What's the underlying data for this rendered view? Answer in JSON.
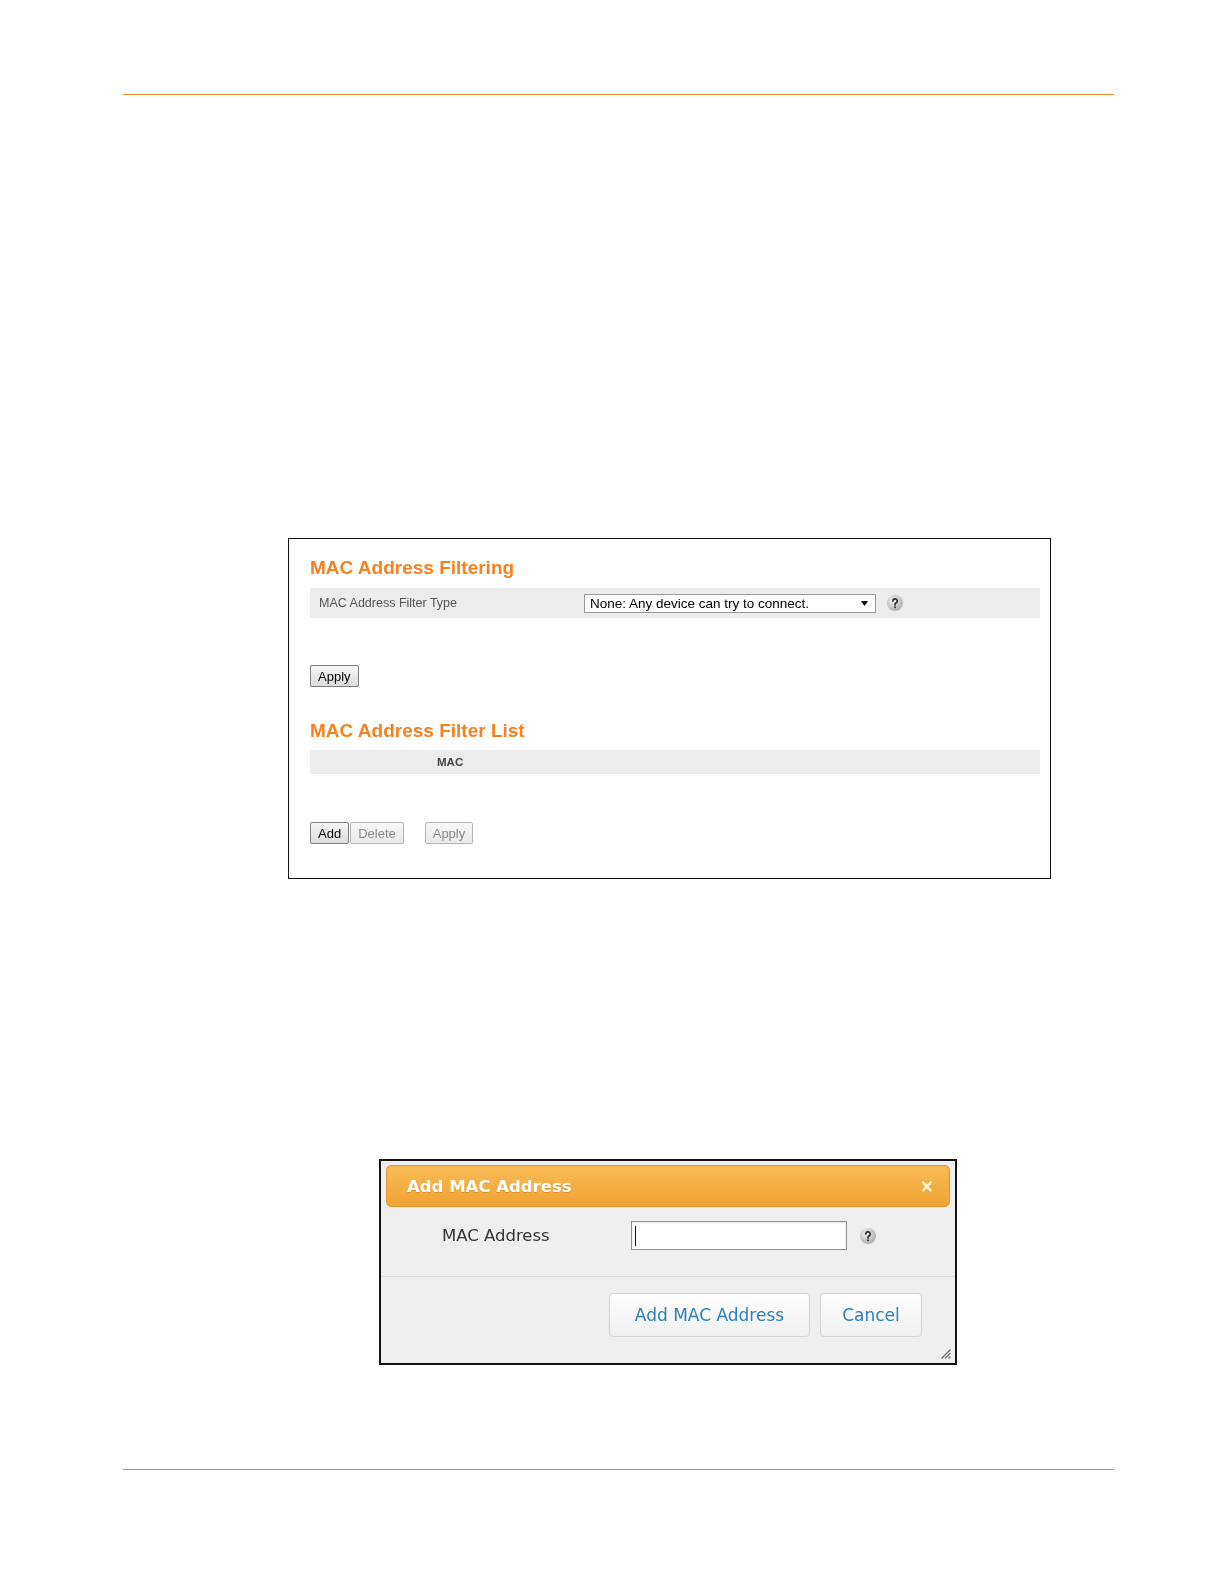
{
  "filter_settings": {
    "title": "MAC Address Filtering",
    "filter_type": {
      "label": "MAC Address Filter Type",
      "value": "None: Any device can try to connect."
    },
    "buttons": [
      {
        "label": "Apply",
        "disabled": false
      }
    ]
  },
  "filter_list": {
    "title": "MAC Address Filter List",
    "columns": [
      "MAC"
    ],
    "button_groups": [
      {
        "buttons": [
          {
            "label": "Add",
            "disabled": false
          },
          {
            "label": "Delete",
            "disabled": true
          }
        ]
      },
      {
        "buttons": [
          {
            "label": "Apply",
            "disabled": true
          }
        ]
      }
    ]
  },
  "dialog": {
    "title": "Add MAC Address",
    "close": "×",
    "fields": [
      {
        "label": "MAC Address",
        "focused": true
      }
    ],
    "buttons": [
      "Add MAC Address",
      "Cancel"
    ]
  }
}
